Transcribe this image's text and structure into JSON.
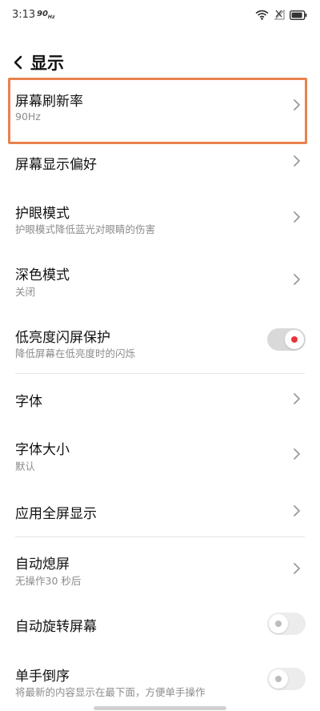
{
  "status_bar": {
    "time": "3:13",
    "refresh_badge": "90",
    "refresh_badge_unit": "Hz"
  },
  "header": {
    "title": "显示"
  },
  "settings": [
    {
      "title": "屏幕刷新率",
      "subtitle": "90Hz",
      "control": "chevron"
    },
    {
      "title": "屏幕显示偏好",
      "control": "chevron"
    },
    {
      "title": "护眼模式",
      "subtitle": "护眼模式降低蓝光对眼睛的伤害",
      "control": "chevron"
    },
    {
      "title": "深色模式",
      "subtitle": "关闭",
      "control": "chevron"
    },
    {
      "title": "低亮度闪屏保护",
      "subtitle": "降低屏幕在低亮度时的闪烁",
      "control": "toggle",
      "state": "on"
    },
    {
      "title": "字体",
      "control": "chevron"
    },
    {
      "title": "字体大小",
      "subtitle": "默认",
      "control": "chevron"
    },
    {
      "title": "应用全屏显示",
      "control": "chevron"
    },
    {
      "title": "自动熄屏",
      "subtitle": "无操作30 秒后",
      "control": "chevron"
    },
    {
      "title": "自动旋转屏幕",
      "control": "toggle",
      "state": "off"
    },
    {
      "title": "单手倒序",
      "subtitle": "将最新的内容显示在最下面，方便单手操作",
      "control": "toggle",
      "state": "off"
    }
  ],
  "colors": {
    "highlight": "#e8824f",
    "toggle_on_dot": "#e8323c",
    "toggle_off_dot": "#bdbdbd"
  }
}
